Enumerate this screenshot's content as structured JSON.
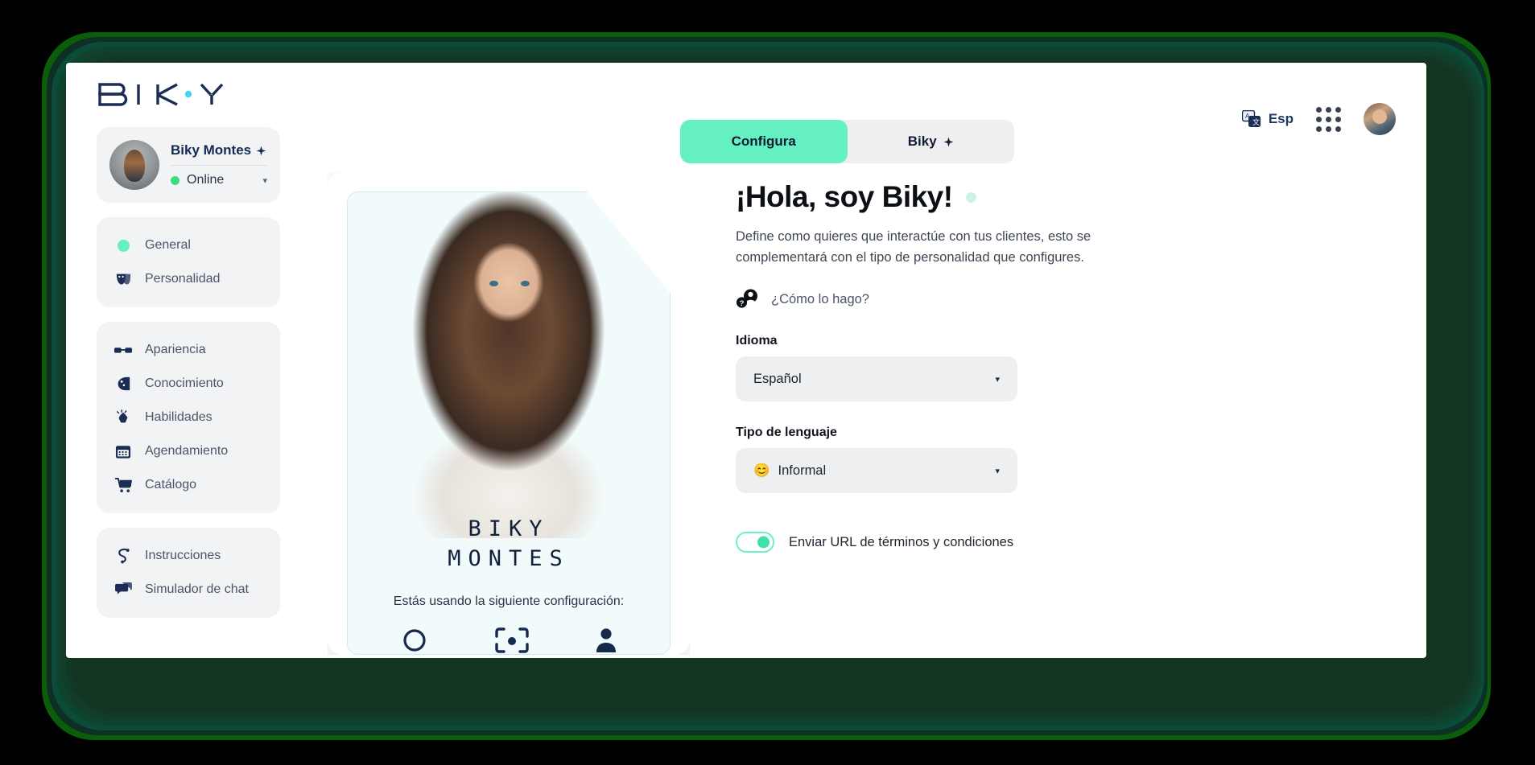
{
  "brand": {
    "logo_text": "BIKY"
  },
  "header": {
    "tabs": [
      {
        "label": "Configura",
        "active": true,
        "name": "tab-configura"
      },
      {
        "label": "Biky",
        "active": false,
        "name": "tab-biky",
        "suffix_icon": "sparkle-icon"
      }
    ],
    "language_switch": {
      "label": "Esp",
      "icon": "translate-icon"
    },
    "apps_grid_icon": "grid-apps-icon",
    "user_avatar": "user-avatar"
  },
  "sidebar": {
    "profile": {
      "name": "Biky Montes",
      "name_badge_icon": "sparkle-icon",
      "status": "Online",
      "status_color": "#3ddc84",
      "caret": "▾"
    },
    "groups": [
      {
        "items": [
          {
            "label": "General",
            "icon": "teal-dot-icon",
            "active": true
          },
          {
            "label": "Personalidad",
            "icon": "masks-icon",
            "active": false
          }
        ]
      },
      {
        "items": [
          {
            "label": "Apariencia",
            "icon": "glasses-icon",
            "active": false
          },
          {
            "label": "Conocimiento",
            "icon": "brain-icon",
            "active": false
          },
          {
            "label": "Habilidades",
            "icon": "clapping-hands-icon",
            "active": false
          },
          {
            "label": "Agendamiento",
            "icon": "calendar-icon",
            "active": false
          },
          {
            "label": "Catálogo",
            "icon": "shopping-cart-icon",
            "active": false
          }
        ]
      },
      {
        "items": [
          {
            "label": "Instrucciones",
            "icon": "flow-s-icon",
            "active": false
          },
          {
            "label": "Simulador de chat",
            "icon": "chat-bubbles-icon",
            "active": false
          }
        ]
      }
    ]
  },
  "bot_card": {
    "name_line1": "BIKY",
    "name_line2": "MONTES",
    "config_label": "Estás usando la siguiente configuración:",
    "icons": [
      "face-outline-icon",
      "scan-face-icon",
      "person-icon"
    ]
  },
  "panel": {
    "title": "¡Hola, soy Biky!",
    "title_dot_color": "#cbf4e6",
    "description": "Define como quieres que interactúe con tus clientes, esto se complementará con el tipo de personalidad que configures.",
    "howto": {
      "label": "¿Cómo lo hago?",
      "icon": "question-person-icon"
    },
    "fields": [
      {
        "label": "Idioma",
        "value": "Español",
        "emoji": "",
        "caret": "▾",
        "name": "idioma-select"
      },
      {
        "label": "Tipo de lenguaje",
        "value": "Informal",
        "emoji": "😊",
        "caret": "▾",
        "name": "tipo-lenguaje-select"
      }
    ],
    "toggle": {
      "label": "Enviar URL de términos y condiciones",
      "on": true,
      "accent": "#3fe0ae"
    }
  },
  "colors": {
    "accent_teal": "#64f0c1",
    "navy": "#152a52",
    "frame_green": "#0b5c0b"
  }
}
